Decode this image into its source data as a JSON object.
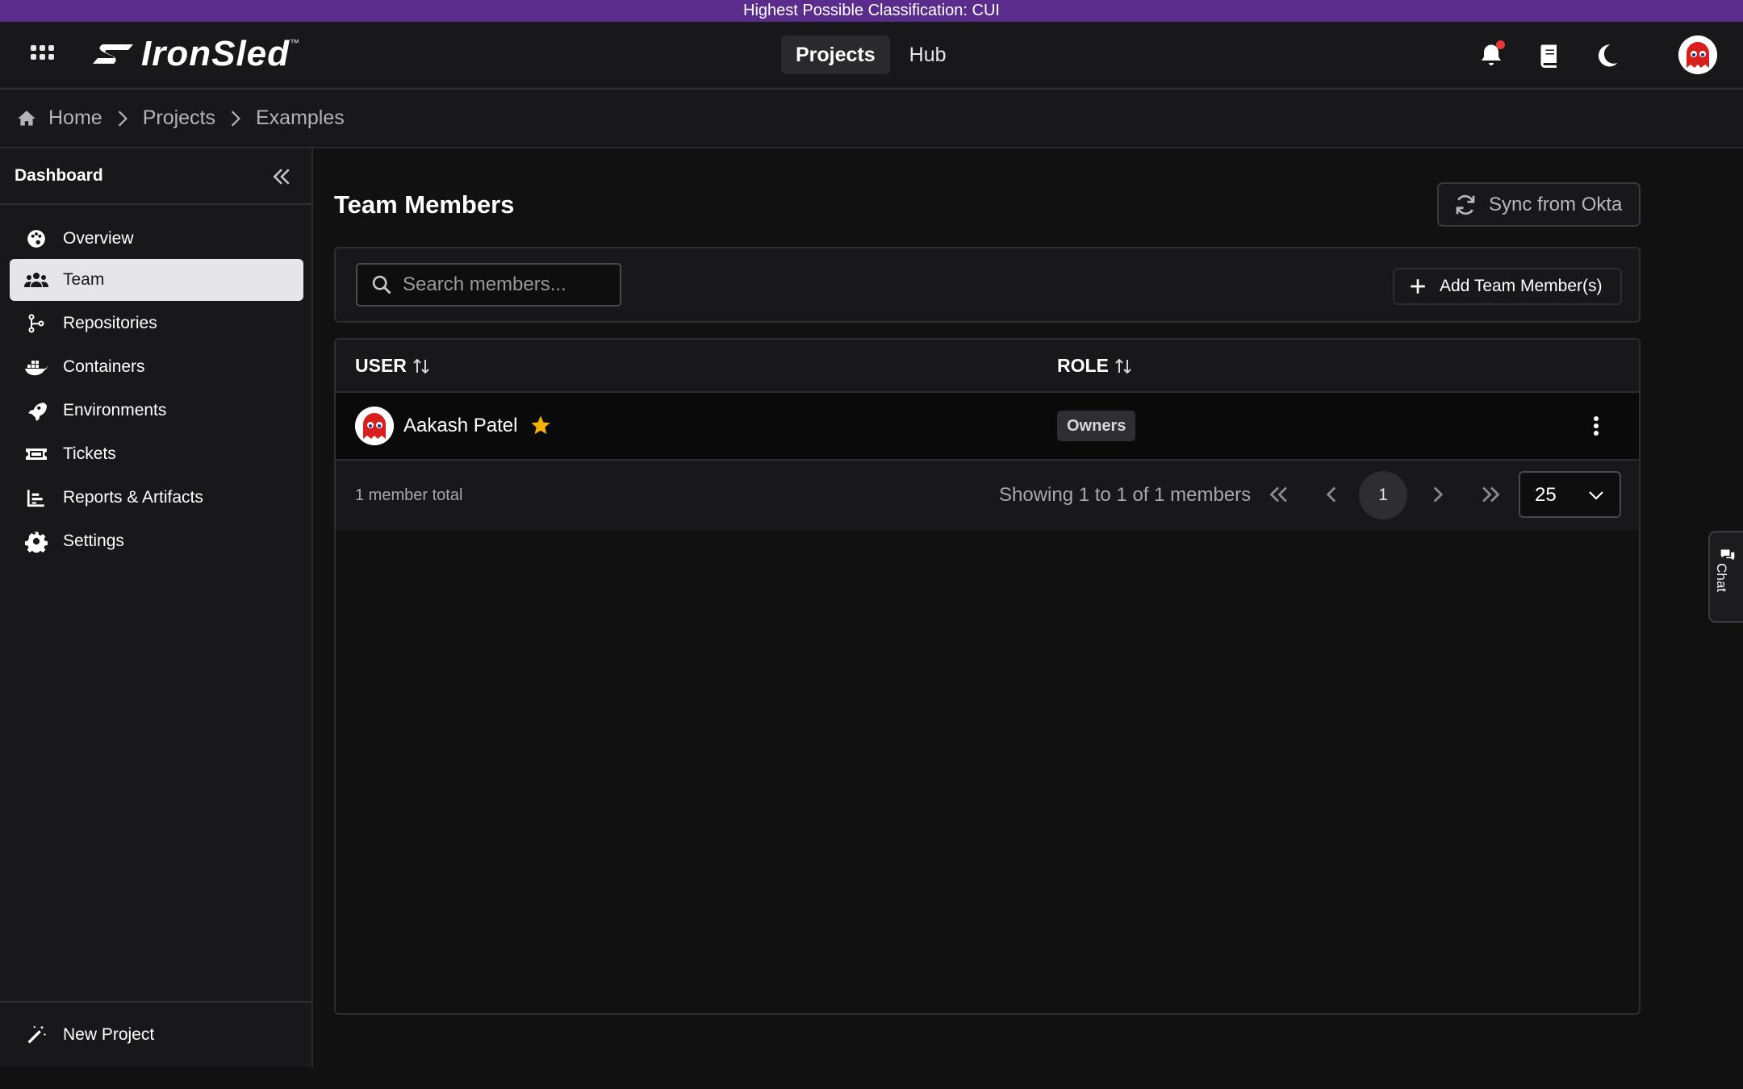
{
  "classification": {
    "text": "Highest Possible Classification: CUI",
    "color": "#5a2d8c"
  },
  "brand": {
    "name": "IronSled",
    "trademark": "™"
  },
  "topnav": {
    "items": [
      {
        "label": "Projects",
        "active": true
      },
      {
        "label": "Hub",
        "active": false
      }
    ]
  },
  "topbar_icons": [
    "apps-grid-icon",
    "bell-icon",
    "book-icon",
    "moon-icon",
    "user-avatar"
  ],
  "breadcrumb": {
    "items": [
      "Home",
      "Projects",
      "Examples"
    ]
  },
  "sidebar": {
    "title": "Dashboard",
    "items": [
      {
        "label": "Overview",
        "icon": "palette-icon"
      },
      {
        "label": "Team",
        "icon": "users-icon",
        "active": true
      },
      {
        "label": "Repositories",
        "icon": "branch-icon"
      },
      {
        "label": "Containers",
        "icon": "docker-icon"
      },
      {
        "label": "Environments",
        "icon": "rocket-icon"
      },
      {
        "label": "Tickets",
        "icon": "ticket-icon"
      },
      {
        "label": "Reports & Artifacts",
        "icon": "chart-icon"
      },
      {
        "label": "Settings",
        "icon": "gear-icon"
      }
    ],
    "footer": {
      "label": "New Project",
      "icon": "magic-wand-icon"
    }
  },
  "main": {
    "title": "Team Members",
    "sync_label": "Sync from Okta",
    "search_placeholder": "Search members...",
    "add_label": "Add Team Member(s)",
    "table": {
      "columns": [
        "USER",
        "ROLE"
      ],
      "rows": [
        {
          "user": "Aakash Patel",
          "role": "Owners",
          "starred": true
        }
      ]
    },
    "total_text": "1 member total",
    "showing_text": "Showing 1 to 1 of 1 members",
    "current_page": "1",
    "page_size": "25"
  },
  "chat": {
    "label": "Chat"
  },
  "colors": {
    "accent_star": "#f5b301",
    "notification_dot": "#e53935"
  }
}
